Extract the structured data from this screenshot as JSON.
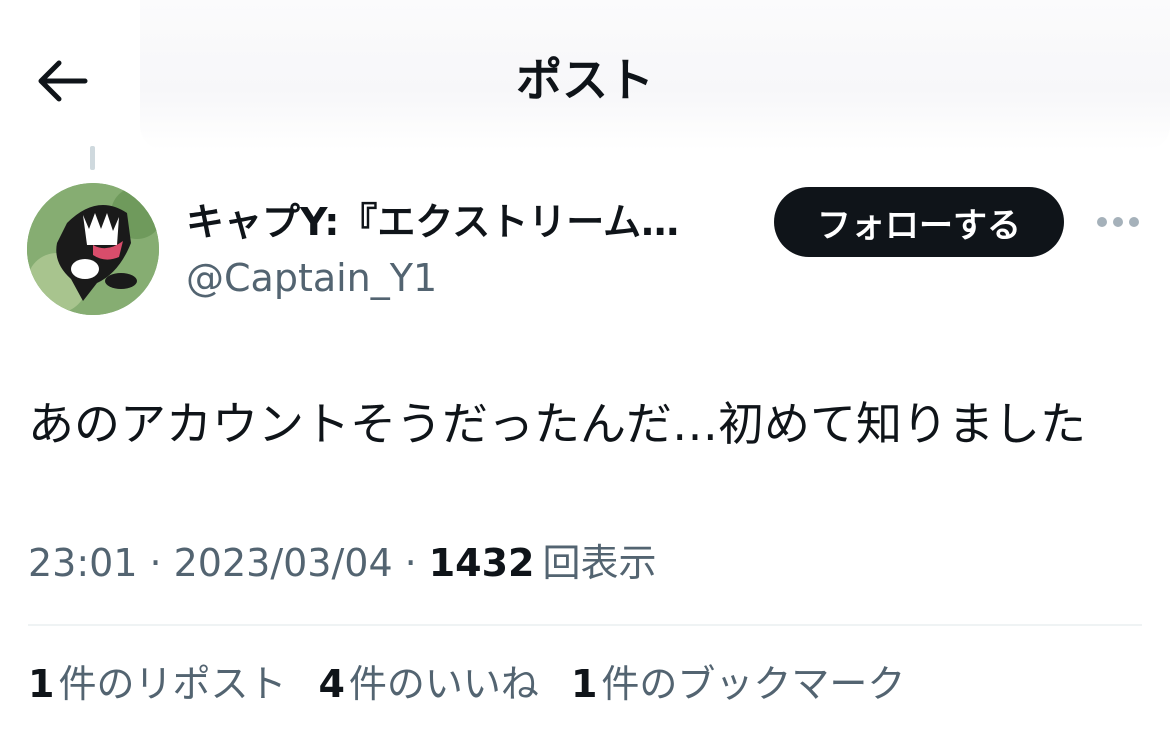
{
  "header": {
    "title": "ポスト",
    "back_icon": "arrow-left-icon"
  },
  "author": {
    "name": "キャプY:『エクストリーム…",
    "handle": "@Captain_Y1",
    "follow_label": "フォローする",
    "more_icon": "more-horizontal-icon"
  },
  "post": {
    "text": "あのアカウントそうだったんだ…初めて知りました",
    "time": "23:01",
    "date": "2023/03/04",
    "views_count": "1432",
    "views_label": "回表示"
  },
  "stats": [
    {
      "count": "1",
      "label": "件のリポスト"
    },
    {
      "count": "4",
      "label": "件のいいね"
    },
    {
      "count": "1",
      "label": "件のブックマーク"
    }
  ],
  "colors": {
    "text_primary": "#0f1419",
    "text_secondary": "#536471",
    "follow_bg": "#0f1419",
    "divider": "#eff3f4"
  }
}
